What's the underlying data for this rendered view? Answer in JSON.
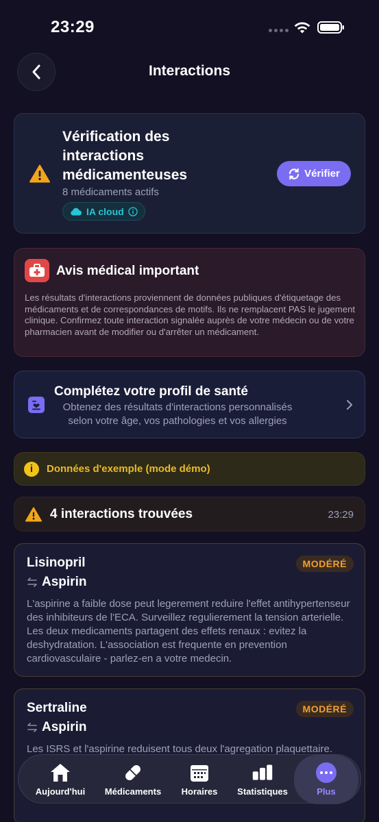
{
  "status": {
    "time": "23:29"
  },
  "header": {
    "title": "Interactions"
  },
  "check": {
    "title": "Vérification des interactions médicamenteuses",
    "subtitle": "8 médicaments actifs",
    "ai_badge": "IA cloud",
    "verify_label": "Vérifier"
  },
  "notice": {
    "title": "Avis médical important",
    "body": "Les résultats d'interactions proviennent de données publiques d'étiquetage des médicaments et de correspondances de motifs. Ils ne remplacent PAS le jugement clinique. Confirmez toute interaction signalée auprès de votre médecin ou de votre pharmacien avant de modifier ou d'arrêter un médicament."
  },
  "profile": {
    "title": "Complétez votre profil de santé",
    "description": "Obtenez des résultats d'interactions personnalisés selon votre âge, vos pathologies et vos allergies"
  },
  "demo": {
    "text": "Données d'exemple (mode démo)"
  },
  "results": {
    "title": "4 interactions trouvées",
    "time": "23:29"
  },
  "interactions": [
    {
      "drug_a": "Lisinopril",
      "drug_b": "Aspirin",
      "severity": "MODÉRÉ",
      "description": "L'aspirine a faible dose peut legerement reduire l'effet antihypertenseur des inhibiteurs de l'ECA. Surveillez regulierement la tension arterielle. Les deux medicaments partagent des effets renaux : evitez la deshydratation. L'association est frequente en prevention cardiovasculaire - parlez-en a votre medecin."
    },
    {
      "drug_a": "Sertraline",
      "drug_b": "Aspirin",
      "severity": "MODÉRÉ",
      "description": "Les ISRS et l'aspirine reduisent tous deux l'agregation plaquettaire."
    }
  ],
  "tabbar": {
    "today": "Aujourd'hui",
    "meds": "Médicaments",
    "schedule": "Horaires",
    "stats": "Statistiques",
    "more": "Plus"
  },
  "colors": {
    "background": "#121022",
    "accent": "#7a6df2",
    "warning": "#f2a51b",
    "danger": "#e04848",
    "cloud": "#2bc3d8"
  }
}
